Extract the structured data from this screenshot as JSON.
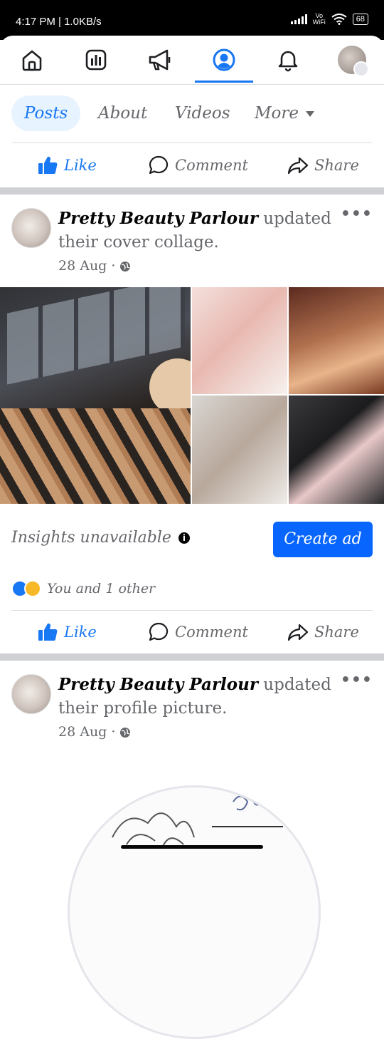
{
  "status_bar": {
    "time_speed": "4:17 PM | 1.0KB/s",
    "vo_label": "Vo\nWiFi",
    "battery": "68"
  },
  "tabs": {
    "posts": "Posts",
    "about": "About",
    "videos": "Videos",
    "more": "More"
  },
  "actions": {
    "like": "Like",
    "comment": "Comment",
    "share": "Share"
  },
  "post1": {
    "name": "Pretty Beauty Parlour",
    "text": "updated their cover collage.",
    "date": "28 Aug",
    "insights": "Insights unavailable",
    "create_ad": "Create ad",
    "reactions": "You and 1 other"
  },
  "post2": {
    "name": "Pretty Beauty Parlour",
    "text": "updated their profile picture.",
    "date": "28 Aug"
  },
  "colors": {
    "accent": "#1877f2",
    "button": "#0866ff",
    "gap": "#ced0d4",
    "muted": "#65676b"
  }
}
